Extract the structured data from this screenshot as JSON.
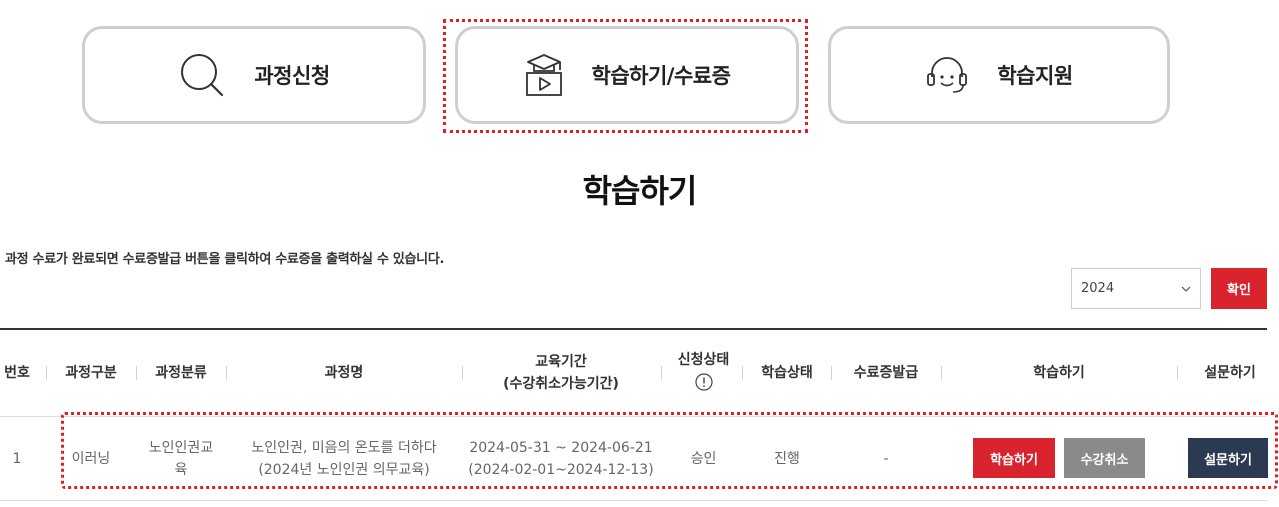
{
  "nav": {
    "apply": {
      "label": "과정신청",
      "icon": "search-icon"
    },
    "study": {
      "label": "학습하기/수료증",
      "icon": "graduation-video-icon"
    },
    "support": {
      "label": "학습지원",
      "icon": "headset-icon"
    }
  },
  "page": {
    "title": "학습하기",
    "notice": "과정 수료가 완료되면 수료증발급 버튼을 클릭하여 수료증을 출력하실 수 있습니다."
  },
  "filter": {
    "year": "2024",
    "confirm_label": "확인"
  },
  "table": {
    "headers": {
      "no": "번호",
      "course_type": "과정구분",
      "category": "과정분류",
      "course_name": "과정명",
      "period_line1": "교육기간",
      "period_line2": "(수강취소가능기간)",
      "apply_status": "신청상태",
      "study_status": "학습상태",
      "certificate": "수료증발급",
      "study": "학습하기",
      "survey": "설문하기"
    },
    "rows": [
      {
        "no": "1",
        "course_type": "이러닝",
        "category_line1": "노인인권교",
        "category_line2": "육",
        "course_name_line1": "노인인권, 미음의 온도를 더하다",
        "course_name_line2": "(2024년 노인인권 의무교육)",
        "period_line1": "2024-05-31 ~ 2024-06-21",
        "period_line2": "(2024-02-01~2024-12-13)",
        "apply_status": "승인",
        "study_status": "진행",
        "certificate": "-",
        "study_button": "학습하기",
        "cancel_button": "수강취소",
        "survey_button": "설문하기"
      }
    ]
  },
  "colors": {
    "primary_red": "#d9232d",
    "cancel_gray": "#8a8a8a",
    "survey_navy": "#2b3a52",
    "highlight_dashed": "#e02020"
  }
}
